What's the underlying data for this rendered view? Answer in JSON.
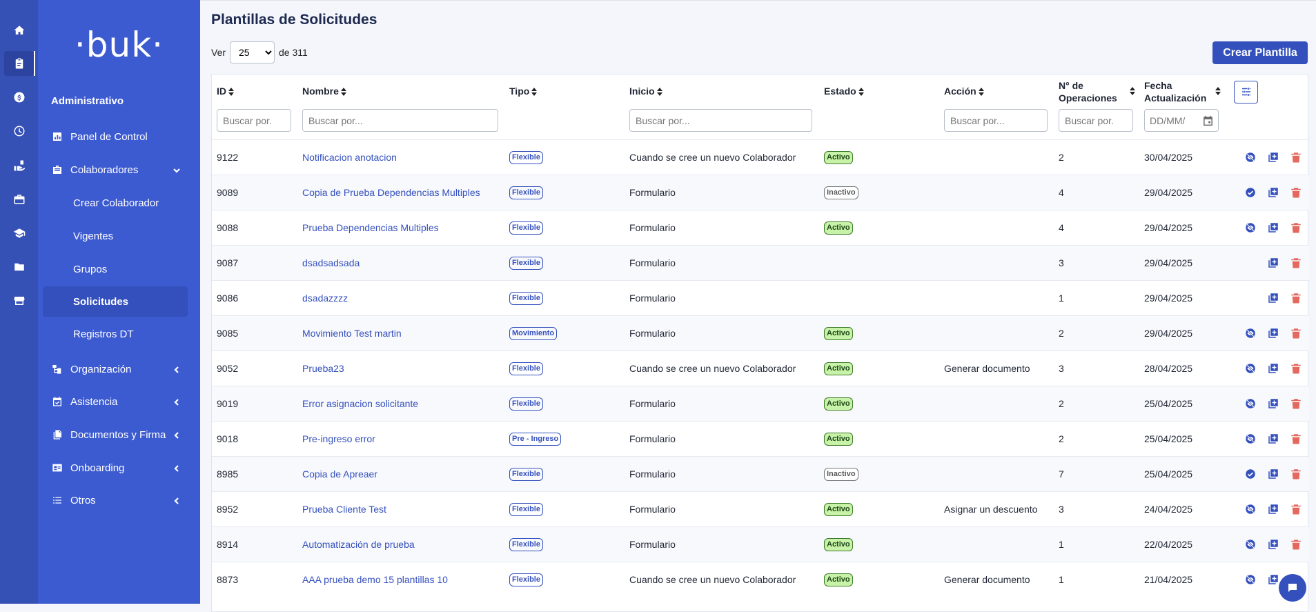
{
  "rail": {
    "icons": [
      "home-icon",
      "clipboard-icon",
      "money-icon",
      "clock-icon",
      "hand-icon",
      "briefcase-icon",
      "graduation-icon",
      "folder-icon",
      "store-icon"
    ]
  },
  "sidebar": {
    "logo": "·buk·",
    "section": "Administrativo",
    "items": [
      {
        "label": "Panel de Control",
        "icon": "dashboard-icon"
      },
      {
        "label": "Colaboradores",
        "icon": "people-icon"
      },
      {
        "label": "Organización",
        "icon": "org-chart-icon"
      },
      {
        "label": "Asistencia",
        "icon": "calendar-check-icon"
      },
      {
        "label": "Documentos y Firma",
        "icon": "documents-icon"
      },
      {
        "label": "Onboarding",
        "icon": "id-card-icon"
      },
      {
        "label": "Otros",
        "icon": "list-icon"
      }
    ],
    "sub_items": [
      {
        "label": "Crear Colaborador"
      },
      {
        "label": "Vigentes"
      },
      {
        "label": "Grupos"
      },
      {
        "label": "Solicitudes"
      },
      {
        "label": "Registros DT"
      }
    ]
  },
  "main": {
    "title": "Plantillas de Solicitudes",
    "pager": {
      "prefix": "Ver",
      "page_size": "25",
      "suffix": "de 311"
    },
    "create_button": "Crear Plantilla",
    "columns": {
      "id": "ID",
      "nombre": "Nombre",
      "tipo": "Tipo",
      "inicio": "Inicio",
      "estado": "Estado",
      "accion": "Acción",
      "ops_line1": "N° de",
      "ops_line2": "Operaciones",
      "fecha_line1": "Fecha",
      "fecha_line2": "Actualización"
    },
    "filters": {
      "id": "Buscar por.",
      "nombre": "Buscar por...",
      "inicio": "Buscar por...",
      "accion": "Buscar por...",
      "ops": "Buscar por.",
      "fecha": "DD/MM/"
    },
    "rows": [
      {
        "id": "9122",
        "nombre": "Notificacion anotacion",
        "tipo": "Flexible",
        "inicio": "Cuando se cree un nuevo Colaborador",
        "estado": "Activo",
        "accion": "",
        "ops": "2",
        "fecha": "30/04/2025",
        "toggle": "hide"
      },
      {
        "id": "9089",
        "nombre": "Copia de Prueba Dependencias Multiples",
        "tipo": "Flexible",
        "inicio": "Formulario",
        "estado": "Inactivo",
        "accion": "",
        "ops": "4",
        "fecha": "29/04/2025",
        "toggle": "check"
      },
      {
        "id": "9088",
        "nombre": "Prueba Dependencias Multiples",
        "tipo": "Flexible",
        "inicio": "Formulario",
        "estado": "Activo",
        "accion": "",
        "ops": "4",
        "fecha": "29/04/2025",
        "toggle": "hide"
      },
      {
        "id": "9087",
        "nombre": "dsadsadsada",
        "tipo": "Flexible",
        "inicio": "Formulario",
        "estado": "",
        "accion": "",
        "ops": "3",
        "fecha": "29/04/2025",
        "toggle": ""
      },
      {
        "id": "9086",
        "nombre": "dsadazzzz",
        "tipo": "Flexible",
        "inicio": "Formulario",
        "estado": "",
        "accion": "",
        "ops": "1",
        "fecha": "29/04/2025",
        "toggle": ""
      },
      {
        "id": "9085",
        "nombre": "Movimiento Test martin",
        "tipo": "Movimiento",
        "inicio": "Formulario",
        "estado": "Activo",
        "accion": "",
        "ops": "2",
        "fecha": "29/04/2025",
        "toggle": "hide"
      },
      {
        "id": "9052",
        "nombre": "Prueba23",
        "tipo": "Flexible",
        "inicio": "Cuando se cree un nuevo Colaborador",
        "estado": "Activo",
        "accion": "Generar documento",
        "ops": "3",
        "fecha": "28/04/2025",
        "toggle": "hide"
      },
      {
        "id": "9019",
        "nombre": "Error asignacion solicitante",
        "tipo": "Flexible",
        "inicio": "Formulario",
        "estado": "Activo",
        "accion": "",
        "ops": "2",
        "fecha": "25/04/2025",
        "toggle": "hide"
      },
      {
        "id": "9018",
        "nombre": "Pre-ingreso error",
        "tipo": "Pre - Ingreso",
        "inicio": "Formulario",
        "estado": "Activo",
        "accion": "",
        "ops": "2",
        "fecha": "25/04/2025",
        "toggle": "hide"
      },
      {
        "id": "8985",
        "nombre": "Copia de Apreaer",
        "tipo": "Flexible",
        "inicio": "Formulario",
        "estado": "Inactivo",
        "accion": "",
        "ops": "7",
        "fecha": "25/04/2025",
        "toggle": "check"
      },
      {
        "id": "8952",
        "nombre": "Prueba Cliente Test",
        "tipo": "Flexible",
        "inicio": "Formulario",
        "estado": "Activo",
        "accion": "Asignar un descuento",
        "ops": "3",
        "fecha": "24/04/2025",
        "toggle": "hide"
      },
      {
        "id": "8914",
        "nombre": "Automatización de prueba",
        "tipo": "Flexible",
        "inicio": "Formulario",
        "estado": "Activo",
        "accion": "",
        "ops": "1",
        "fecha": "22/04/2025",
        "toggle": "hide"
      },
      {
        "id": "8873",
        "nombre": "AAA prueba demo 15 plantillas 10",
        "tipo": "Flexible",
        "inicio": "Cuando se cree un nuevo Colaborador",
        "estado": "Activo",
        "accion": "Generar documento",
        "ops": "1",
        "fecha": "21/04/2025",
        "toggle": "hide"
      }
    ]
  },
  "colors": {
    "rail": "#3651b5",
    "sidebar": "#3d5bd1",
    "primary": "#3450bd",
    "delete": "#e5685e",
    "active_badge_bg": "#c8f2a8"
  }
}
